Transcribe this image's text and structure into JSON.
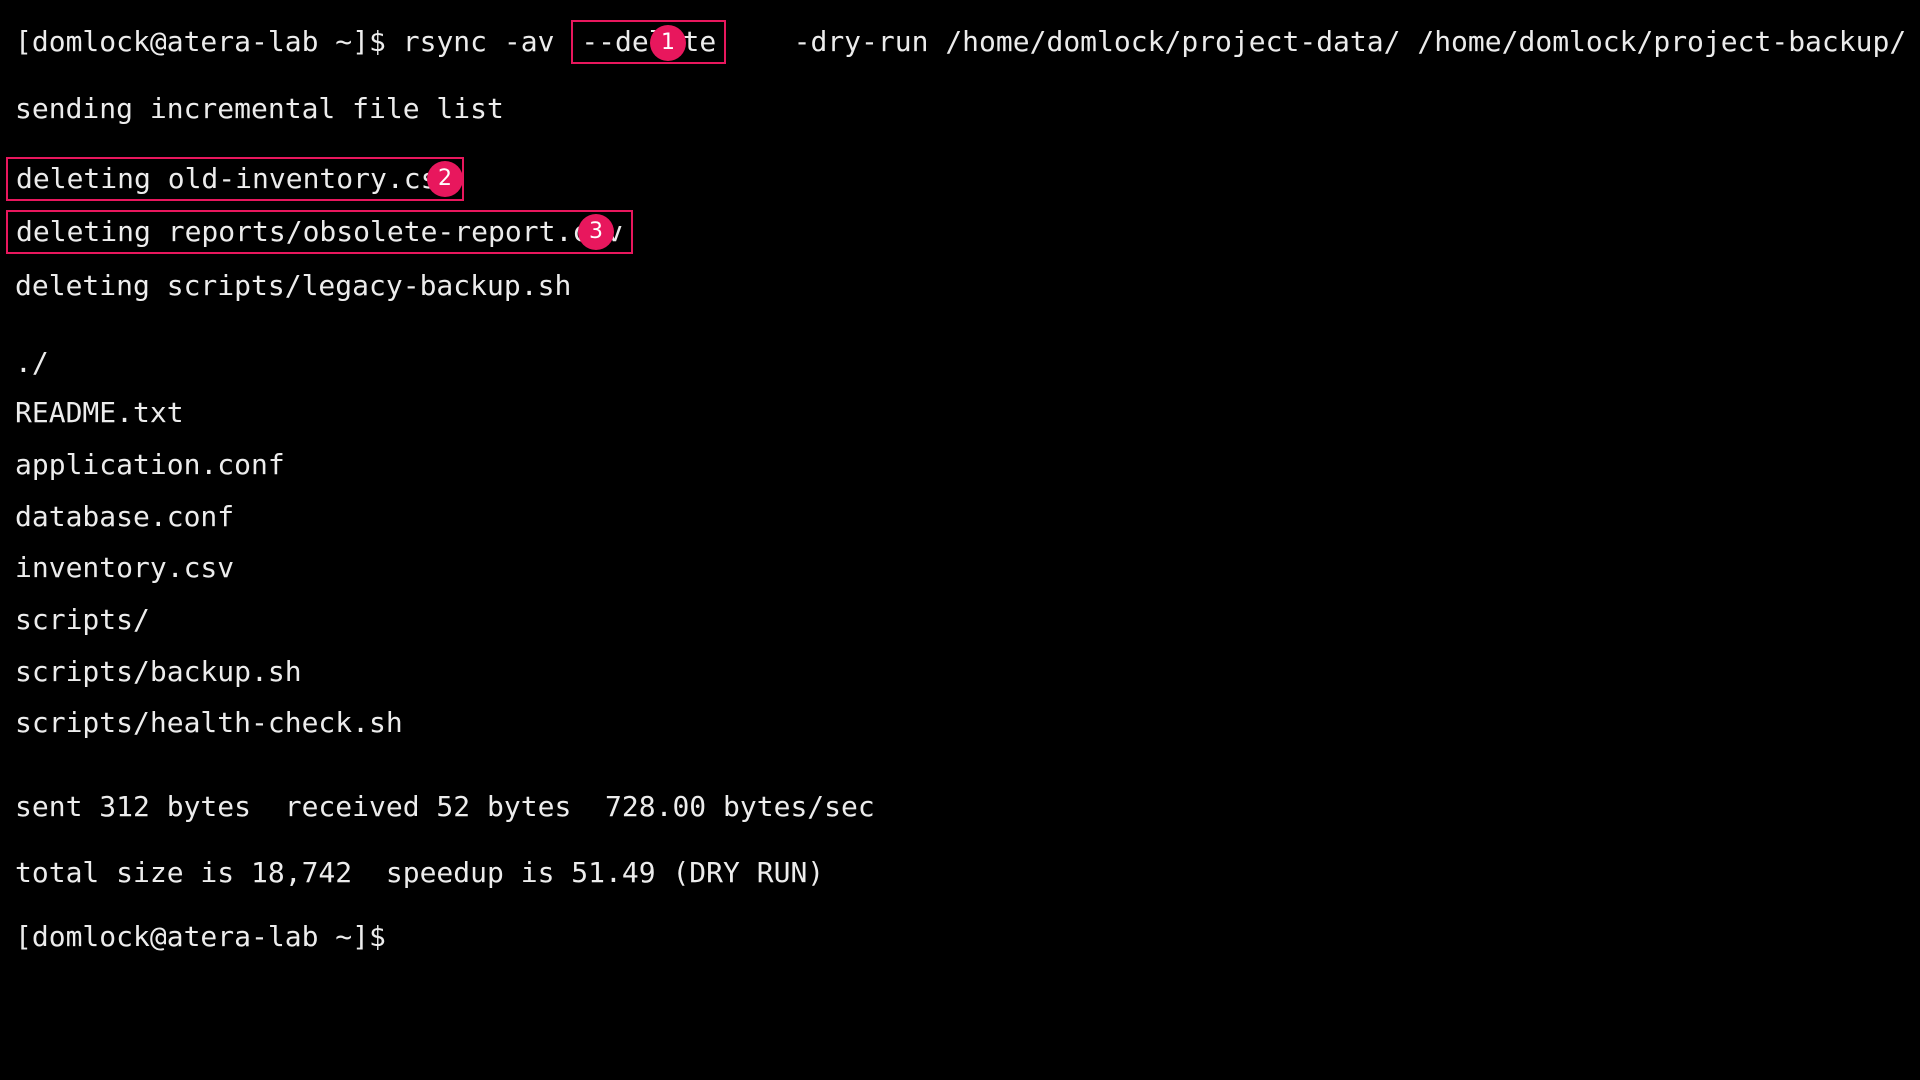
{
  "terminal": {
    "command_line": {
      "prompt": "[domlock@atera-lab ~]$",
      "command_before": "rsync -av",
      "highlighted_flag": "--delete",
      "command_after": "-dry-run /home/domlock/project-data/ /home/domlock/project-backup/"
    },
    "header_line": "sending incremental file list",
    "deleted": [
      "deleting old-inventory.csv",
      "deleting reports/obsolete-report.csv",
      "deleting scripts/legacy-backup.sh"
    ],
    "files": [
      "./",
      "README.txt",
      "application.conf",
      "database.conf",
      "inventory.csv",
      "scripts/",
      "scripts/backup.sh",
      "scripts/health-check.sh"
    ],
    "summary_sent": "sent 312 bytes  received 52 bytes  728.00 bytes/sec",
    "summary_total": "total size is 18,742  speedup is 51.49 (DRY RUN)",
    "final_prompt": "[domlock@atera-lab ~]$"
  },
  "annotations": {
    "badge_1": "1",
    "badge_2": "2",
    "badge_3": "3",
    "highlight_color": "#e8175d"
  },
  "colors": {
    "background": "#000000",
    "text": "#ececec"
  }
}
